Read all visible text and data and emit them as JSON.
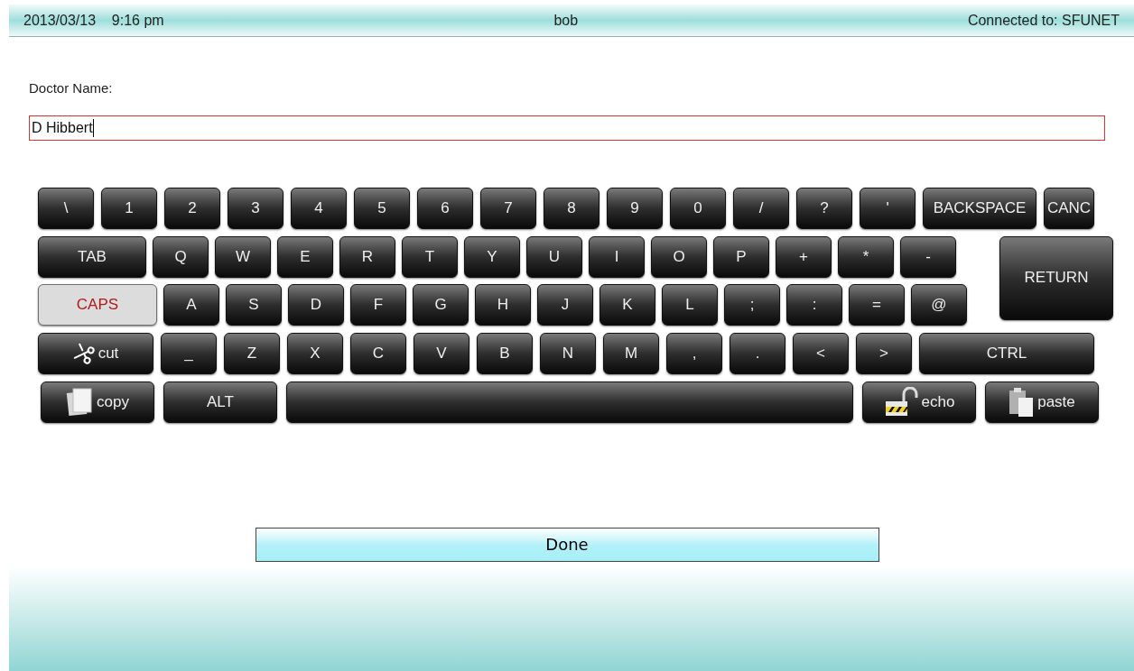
{
  "status_bar": {
    "datetime": "2013/03/13    9:16 pm",
    "user": "bob",
    "connection": "Connected to: SFUNET"
  },
  "field": {
    "label": "Doctor Name:",
    "value": "D Hibbert"
  },
  "keyboard": {
    "rows": [
      {
        "keys": [
          {
            "label": "\\",
            "kind": "char"
          },
          {
            "label": "1",
            "kind": "char"
          },
          {
            "label": "2",
            "kind": "char"
          },
          {
            "label": "3",
            "kind": "char"
          },
          {
            "label": "4",
            "kind": "char"
          },
          {
            "label": "5",
            "kind": "char"
          },
          {
            "label": "6",
            "kind": "char"
          },
          {
            "label": "7",
            "kind": "char"
          },
          {
            "label": "8",
            "kind": "char"
          },
          {
            "label": "9",
            "kind": "char"
          },
          {
            "label": "0",
            "kind": "char"
          },
          {
            "label": "/",
            "kind": "char"
          },
          {
            "label": "?",
            "kind": "char"
          },
          {
            "label": "'",
            "kind": "char"
          },
          {
            "label": "BACKSPACE",
            "kind": "function"
          },
          {
            "label": "CANC",
            "kind": "function"
          }
        ]
      },
      {
        "keys": [
          {
            "label": "TAB",
            "kind": "function"
          },
          {
            "label": "Q",
            "kind": "char"
          },
          {
            "label": "W",
            "kind": "char"
          },
          {
            "label": "E",
            "kind": "char"
          },
          {
            "label": "R",
            "kind": "char"
          },
          {
            "label": "T",
            "kind": "char"
          },
          {
            "label": "Y",
            "kind": "char"
          },
          {
            "label": "U",
            "kind": "char"
          },
          {
            "label": "I",
            "kind": "char"
          },
          {
            "label": "O",
            "kind": "char"
          },
          {
            "label": "P",
            "kind": "char"
          },
          {
            "label": "+",
            "kind": "char"
          },
          {
            "label": "*",
            "kind": "char"
          },
          {
            "label": "-",
            "kind": "char"
          }
        ]
      },
      {
        "keys": [
          {
            "label": "CAPS",
            "kind": "toggle",
            "on": true
          },
          {
            "label": "A",
            "kind": "char"
          },
          {
            "label": "S",
            "kind": "char"
          },
          {
            "label": "D",
            "kind": "char"
          },
          {
            "label": "F",
            "kind": "char"
          },
          {
            "label": "G",
            "kind": "char"
          },
          {
            "label": "H",
            "kind": "char"
          },
          {
            "label": "J",
            "kind": "char"
          },
          {
            "label": "K",
            "kind": "char"
          },
          {
            "label": "L",
            "kind": "char"
          },
          {
            "label": ";",
            "kind": "char"
          },
          {
            "label": ":",
            "kind": "char"
          },
          {
            "label": "=",
            "kind": "char"
          },
          {
            "label": "@",
            "kind": "char"
          }
        ]
      },
      {
        "keys": [
          {
            "label": "cut",
            "kind": "cut"
          },
          {
            "label": "_",
            "kind": "char"
          },
          {
            "label": "Z",
            "kind": "char"
          },
          {
            "label": "X",
            "kind": "char"
          },
          {
            "label": "C",
            "kind": "char"
          },
          {
            "label": "V",
            "kind": "char"
          },
          {
            "label": "B",
            "kind": "char"
          },
          {
            "label": "N",
            "kind": "char"
          },
          {
            "label": "M",
            "kind": "char"
          },
          {
            "label": ",",
            "kind": "char"
          },
          {
            "label": ".",
            "kind": "char"
          },
          {
            "label": "<",
            "kind": "char"
          },
          {
            "label": ">",
            "kind": "char"
          },
          {
            "label": "CTRL",
            "kind": "function"
          }
        ]
      },
      {
        "keys": [
          {
            "label": "copy",
            "kind": "copy"
          },
          {
            "label": "ALT",
            "kind": "function"
          },
          {
            "kind": "space"
          },
          {
            "label": "echo",
            "kind": "echo"
          },
          {
            "label": "paste",
            "kind": "paste"
          }
        ]
      }
    ],
    "return_key": {
      "label": "RETURN"
    }
  },
  "done_button": {
    "label": "Done"
  }
}
